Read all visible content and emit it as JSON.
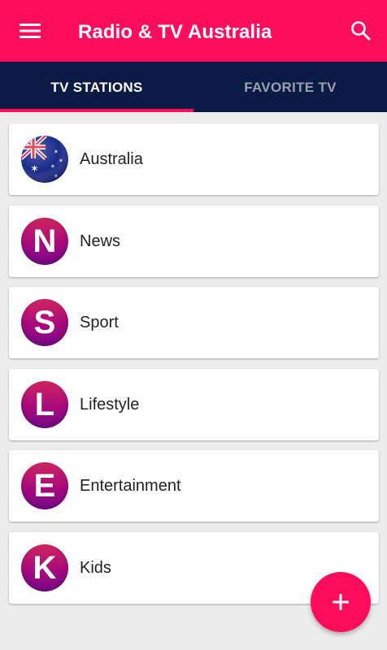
{
  "app": {
    "title": "Radio & TV Australia",
    "accent_color": "#fd0d5b",
    "tabbar_color": "#0b1b45"
  },
  "toolbar": {
    "menu_icon": "hamburger-menu-icon",
    "search_icon": "search-icon"
  },
  "tabs": [
    {
      "label": "TV STATIONS",
      "selected": true
    },
    {
      "label": "FAVORITE TV",
      "selected": false
    }
  ],
  "categories": [
    {
      "label": "Australia",
      "icon": "australia-flag-icon"
    },
    {
      "label": "News",
      "letter": "N"
    },
    {
      "label": "Sport",
      "letter": "S"
    },
    {
      "label": "Lifestyle",
      "letter": "L"
    },
    {
      "label": "Entertainment",
      "letter": "E"
    },
    {
      "label": "Kids",
      "letter": "K"
    }
  ],
  "fab": {
    "icon": "plus-icon"
  }
}
